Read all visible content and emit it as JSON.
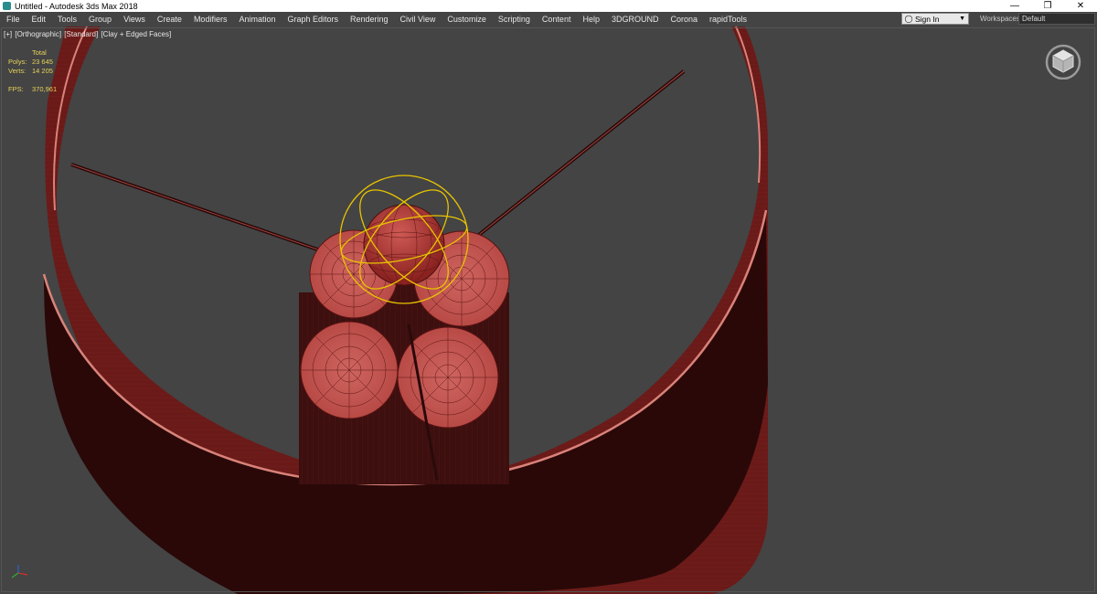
{
  "window": {
    "title": "Untitled - Autodesk 3ds Max 2018",
    "app_icon": "3dsmax-icon",
    "minimize": "—",
    "maximize": "❐",
    "close": "✕"
  },
  "menubar": {
    "items": [
      {
        "label": "File"
      },
      {
        "label": "Edit"
      },
      {
        "label": "Tools"
      },
      {
        "label": "Group"
      },
      {
        "label": "Views"
      },
      {
        "label": "Create"
      },
      {
        "label": "Modifiers"
      },
      {
        "label": "Animation"
      },
      {
        "label": "Graph Editors"
      },
      {
        "label": "Rendering"
      },
      {
        "label": "Civil View"
      },
      {
        "label": "Customize"
      },
      {
        "label": "Scripting"
      },
      {
        "label": "Content"
      },
      {
        "label": "Help"
      },
      {
        "label": "3DGROUND"
      },
      {
        "label": "Corona"
      },
      {
        "label": "rapidTools"
      }
    ],
    "sign_in": "Sign In",
    "workspaces_label": "Workspaces:",
    "workspace_value": "Default"
  },
  "viewport": {
    "label_plus": "[+]",
    "label_view": "[Orthographic]",
    "label_shading": "[Standard]",
    "label_mode": "[Clay + Edged Faces]",
    "stats": {
      "total_label": "Total",
      "polys_label": "Polys:",
      "polys_value": "23 645",
      "verts_label": "Verts:",
      "verts_value": "14 205",
      "fps_label": "FPS:",
      "fps_value": "370,961"
    }
  },
  "colors": {
    "viewport_bg": "#444444",
    "object_dark": "#3a0e0e",
    "object_mid": "#5a1414",
    "object_face": "#c85a55",
    "selection": "#e8c400",
    "stats_text": "#e6d25a"
  }
}
